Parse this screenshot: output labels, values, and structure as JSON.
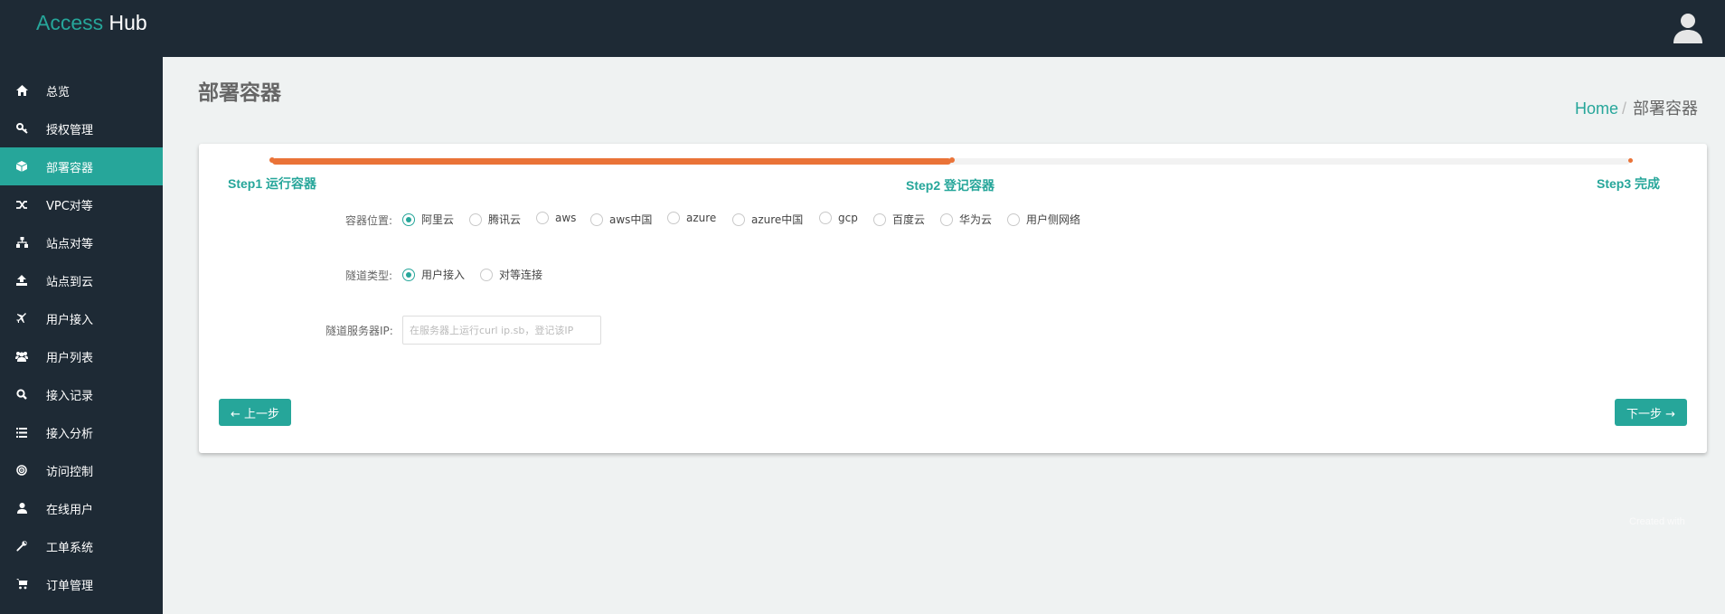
{
  "app": {
    "brand_part1": "Access",
    "brand_part2": "Hub"
  },
  "sidebar": {
    "items": [
      {
        "label": "总览",
        "icon": "home-icon",
        "active": false
      },
      {
        "label": "授权管理",
        "icon": "key-icon",
        "active": false
      },
      {
        "label": "部署容器",
        "icon": "cube-icon",
        "active": true
      },
      {
        "label": "VPC对等",
        "icon": "random-icon",
        "active": false
      },
      {
        "label": "站点对等",
        "icon": "sitemap-icon",
        "active": false
      },
      {
        "label": "站点到云",
        "icon": "upload-icon",
        "active": false
      },
      {
        "label": "用户接入",
        "icon": "plane-icon",
        "active": false
      },
      {
        "label": "用户列表",
        "icon": "users-icon",
        "active": false
      },
      {
        "label": "接入记录",
        "icon": "search-icon",
        "active": false
      },
      {
        "label": "接入分析",
        "icon": "list-icon",
        "active": false
      },
      {
        "label": "访问控制",
        "icon": "target-icon",
        "active": false
      },
      {
        "label": "在线用户",
        "icon": "user-icon",
        "active": false
      },
      {
        "label": "工单系统",
        "icon": "wrench-icon",
        "active": false
      },
      {
        "label": "订单管理",
        "icon": "cart-icon",
        "active": false
      }
    ]
  },
  "page": {
    "title": "部署容器",
    "breadcrumb": {
      "home": "Home",
      "separator": "/",
      "current": "部署容器"
    }
  },
  "wizard": {
    "progress_fraction": 0.5,
    "steps": [
      "Step1 运行容器",
      "Step2 登记容器",
      "Step3 完成"
    ],
    "location_label": "容器位置:",
    "location_options": [
      "阿里云",
      "腾讯云",
      "aws",
      "aws中国",
      "azure",
      "azure中国",
      "gcp",
      "百度云",
      "华为云",
      "用户侧网络"
    ],
    "location_selected": "阿里云",
    "tunnel_label": "隧道类型:",
    "tunnel_options": [
      "用户接入",
      "对等连接"
    ],
    "tunnel_selected": "用户接入",
    "ip_label": "隧道服务器IP:",
    "ip_placeholder": "在服务器上运行curl ip.sb，登记该IP",
    "ip_value": "",
    "prev_button": "← 上一步",
    "next_button": "下一步 →"
  },
  "footer": {
    "text": "Created with"
  },
  "colors": {
    "accent": "#26a69a",
    "progress": "#ea7338",
    "sidebar_bg": "#1e2a35"
  }
}
